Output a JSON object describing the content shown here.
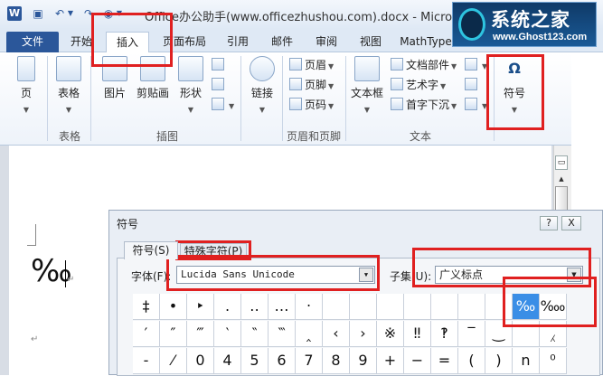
{
  "titlebar": {
    "title": "Office办公助手(www.officezhushou.com).docx - Microsoft ...",
    "quick_access": {
      "undo_icon": "undo-icon",
      "redo_icon": "redo-icon",
      "save_icon": "save-icon"
    }
  },
  "watermark": {
    "title": "系统之家",
    "url": "www.Ghost123.com"
  },
  "tabs": [
    "文件",
    "开始",
    "插入",
    "页面布局",
    "引用",
    "邮件",
    "审阅",
    "视图",
    "MathType"
  ],
  "ribbon": {
    "pages": {
      "label": "页"
    },
    "tables": {
      "button": "表格",
      "group": "表格"
    },
    "illustrations": {
      "picture": "图片",
      "clipart": "剪贴画",
      "shapes": "形状",
      "group": "插图"
    },
    "links": {
      "button": "链接"
    },
    "header_footer": {
      "header": "页眉",
      "footer": "页脚",
      "page_number": "页码",
      "group": "页眉和页脚"
    },
    "text": {
      "textbox": "文本框",
      "quickparts": "文档部件",
      "wordart": "艺术字",
      "dropcap": "首字下沉",
      "group": "文本"
    },
    "symbols": {
      "button": "符号",
      "glyph": "Ω"
    }
  },
  "document": {
    "symbol_text": "‰",
    "para_mark": "↵"
  },
  "dialog": {
    "title": "符号",
    "help": "?",
    "close": "X",
    "tab_symbols": "符号(S)",
    "tab_special": "特殊字符(P)",
    "font_label": "字体(F):",
    "font_value": "Lucida Sans Unicode",
    "subset_label": "子集(U):",
    "subset_value": "广义标点",
    "grid_rows": [
      [
        "‡",
        "•",
        "‣",
        "․",
        "‥",
        "…",
        "‧",
        "",
        "",
        "",
        "",
        "",
        "",
        "",
        "‰",
        "‱"
      ],
      [
        "′",
        "″",
        "‴",
        "‵",
        "‶",
        "‷",
        "‸",
        "‹",
        "›",
        "※",
        "‼",
        "‽",
        "‾",
        "‿",
        "⁀",
        "⁁"
      ],
      [
        "-",
        "⁄",
        "0",
        "4",
        "5",
        "6",
        "7",
        "8",
        "9",
        "+",
        "−",
        "=",
        "(",
        ")",
        "n",
        "⁰"
      ]
    ],
    "selected_symbol": "‰"
  }
}
